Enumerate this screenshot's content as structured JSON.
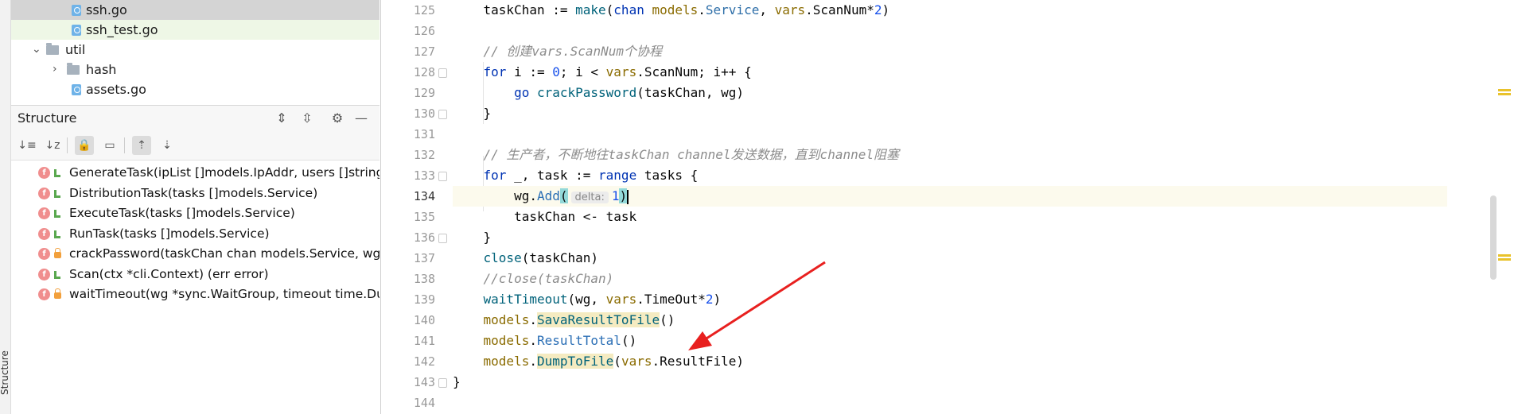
{
  "side_tab": {
    "label": "Structure"
  },
  "project_tree": [
    {
      "label": "ssh.go",
      "type": "go-file",
      "state": "selected",
      "indent": 1
    },
    {
      "label": "ssh_test.go",
      "type": "go-file",
      "state": "changed",
      "indent": 1
    },
    {
      "label": "util",
      "type": "folder",
      "state": "expanded",
      "indent": 0
    },
    {
      "label": "hash",
      "type": "folder",
      "state": "collapsed",
      "indent": 1
    },
    {
      "label": "assets.go",
      "type": "go-file",
      "state": "normal",
      "indent": 1
    }
  ],
  "structure": {
    "title": "Structure",
    "items": [
      {
        "signature": "GenerateTask(ipList []models.IpAddr, users []string, pa",
        "visibility": "public"
      },
      {
        "signature": "DistributionTask(tasks []models.Service)",
        "visibility": "public"
      },
      {
        "signature": "ExecuteTask(tasks []models.Service)",
        "visibility": "public"
      },
      {
        "signature": "RunTask(tasks []models.Service)",
        "visibility": "public"
      },
      {
        "signature": "crackPassword(taskChan chan models.Service, wg *syn",
        "visibility": "private"
      },
      {
        "signature": "Scan(ctx *cli.Context) (err error)",
        "visibility": "public"
      },
      {
        "signature": "waitTimeout(wg *sync.WaitGroup, timeout time.Durat",
        "visibility": "private"
      }
    ]
  },
  "editor": {
    "current_line": 134,
    "line_numbers": [
      "125",
      "126",
      "127",
      "128",
      "129",
      "130",
      "131",
      "132",
      "133",
      "134",
      "135",
      "136",
      "137",
      "138",
      "139",
      "140",
      "141",
      "142",
      "143",
      "144"
    ],
    "annotation": {
      "type": "red-arrow",
      "color": "#e8201f"
    },
    "inlay_hint": "delta:"
  }
}
